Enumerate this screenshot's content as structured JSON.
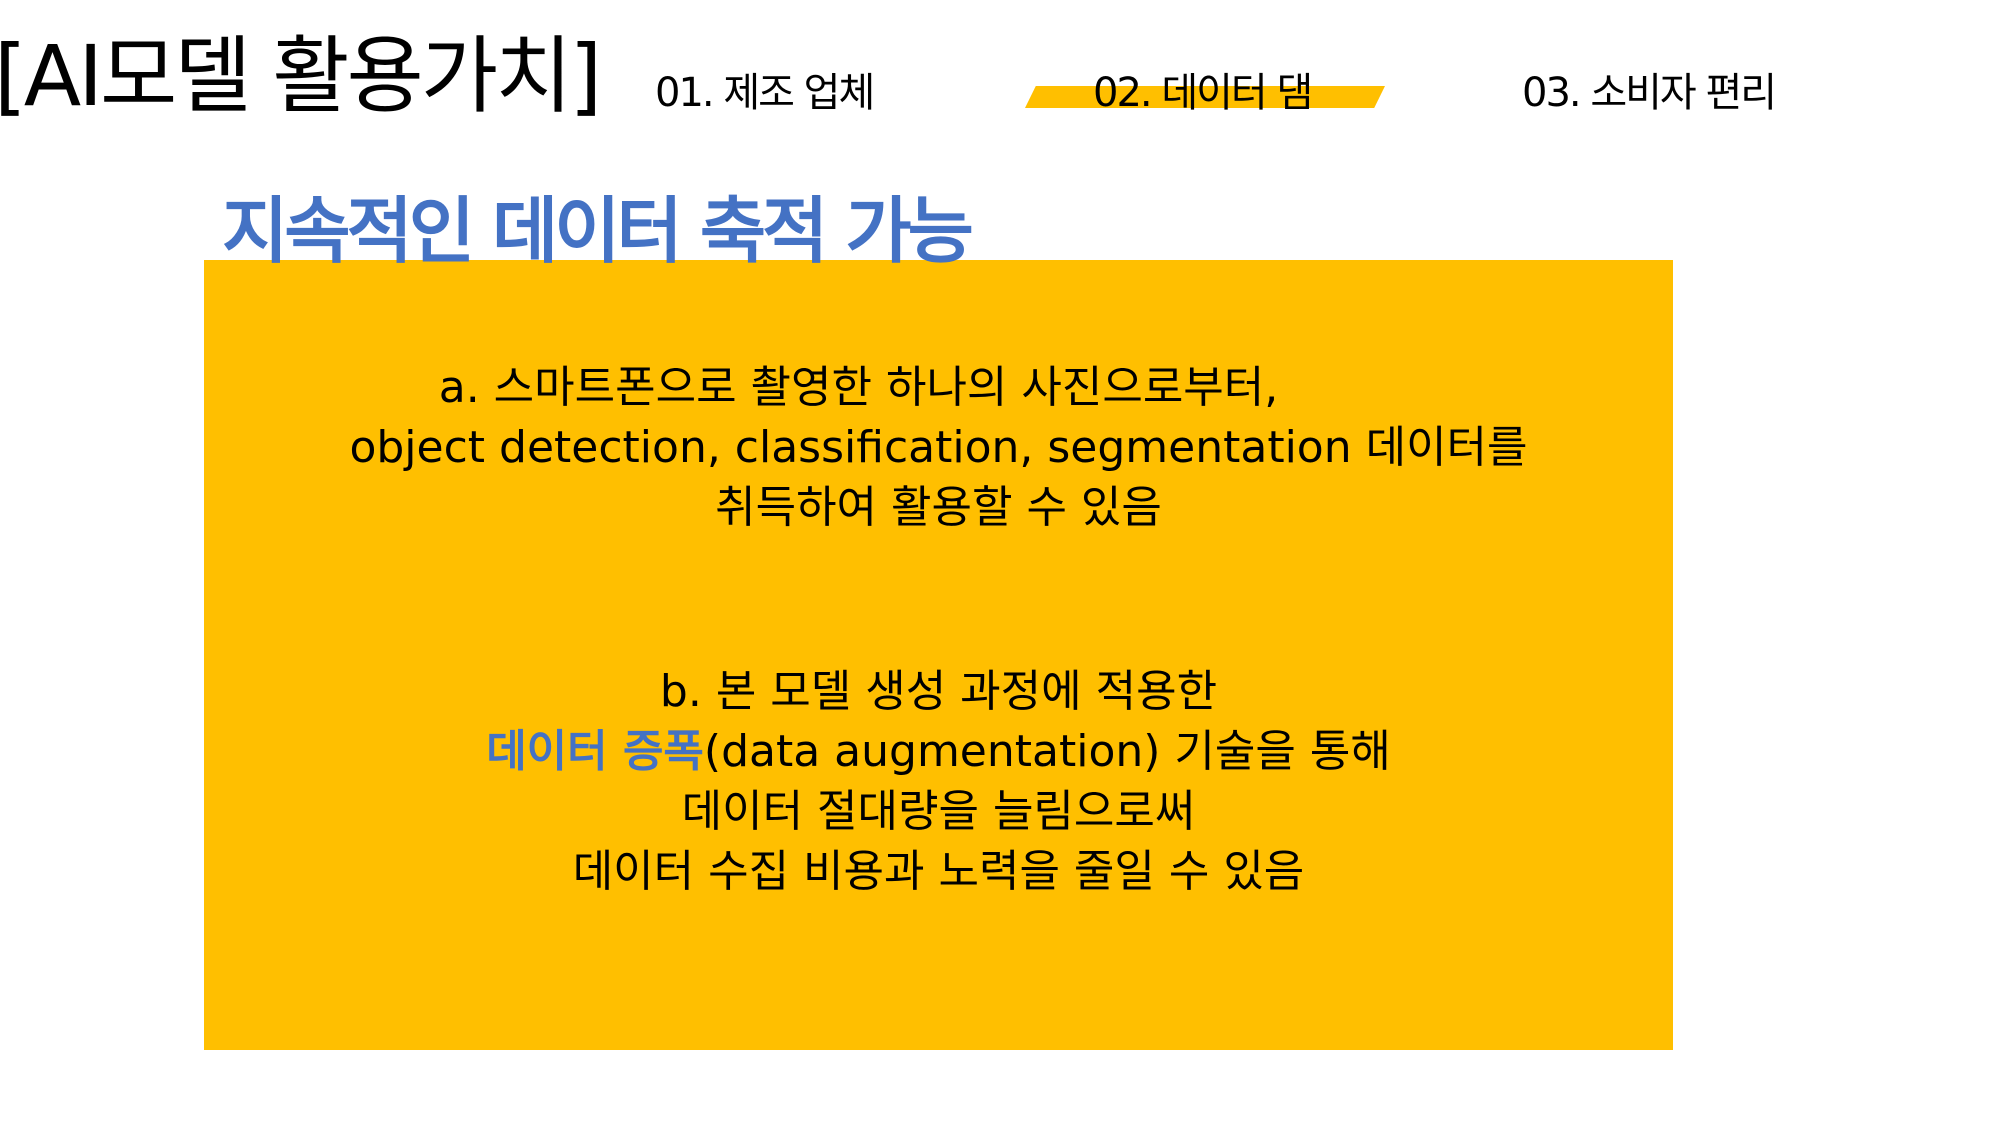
{
  "page_title": "[AI모델 활용가치]",
  "nav_tabs": [
    {
      "label": "01. 제조 업체",
      "active": false
    },
    {
      "label": "02. 데이터 댐",
      "active": true
    },
    {
      "label": "03. 소비자 편리",
      "active": false
    }
  ],
  "section_heading": "지속적인 데이터 축적 가능",
  "paragraph_a": {
    "line1": "a.   스마트폰으로 촬영한 하나의 사진으로부터,",
    "line2": "object detection, classification, segmentation 데이터를",
    "line3": "취득하여 활용할 수 있음"
  },
  "paragraph_b": {
    "line1": "b. 본 모델 생성 과정에 적용한",
    "line2_highlight": "데이터 증폭",
    "line2_rest": "(data augmentation) 기술을 통해",
    "line3": "데이터 절대량을 늘림으로써",
    "line4": "데이터 수집 비용과 노력을 줄일 수 있음"
  },
  "colors": {
    "accent_blue": "#4472C4",
    "highlight_yellow": "#FFBF00",
    "text": "#000000",
    "background": "#FFFFFF"
  }
}
